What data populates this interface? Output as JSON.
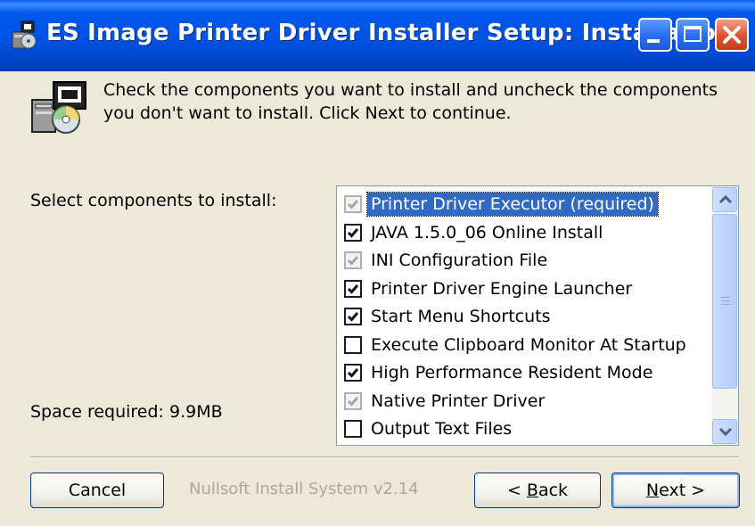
{
  "window": {
    "title": "ES Image Printer Driver Installer Setup: Installatio...",
    "controls": [
      "minimize",
      "maximize",
      "close"
    ]
  },
  "header": {
    "description_line1": "Check the components you want to install and uncheck the components",
    "description_line2": "you don't want to install. Click Next to continue."
  },
  "components": {
    "select_label": "Select components to install:",
    "space_required": "Space required: 9.9MB",
    "items": [
      {
        "label": "Printer Driver Executor (required)",
        "state": "checked-disabled",
        "selected": true
      },
      {
        "label": "JAVA 1.5.0_06 Online Install",
        "state": "checked"
      },
      {
        "label": "INI Configuration File",
        "state": "checked-disabled"
      },
      {
        "label": "Printer Driver Engine Launcher",
        "state": "checked"
      },
      {
        "label": "Start Menu Shortcuts",
        "state": "checked"
      },
      {
        "label": "Execute Clipboard Monitor At Startup",
        "state": "unchecked"
      },
      {
        "label": "High Performance Resident Mode",
        "state": "checked"
      },
      {
        "label": "Native Printer Driver",
        "state": "checked-disabled"
      },
      {
        "label": "Output Text Files",
        "state": "unchecked"
      }
    ]
  },
  "footer": {
    "cancel_label": "Cancel",
    "branding": "Nullsoft Install System v2.14",
    "back_prefix": "< ",
    "back_accel": "B",
    "back_rest": "ack",
    "next_accel": "N",
    "next_rest": "ext >"
  },
  "colors": {
    "titlebar": "#0054e3",
    "face": "#ece9d8",
    "selection": "#316ac5",
    "close": "#e0512c"
  }
}
